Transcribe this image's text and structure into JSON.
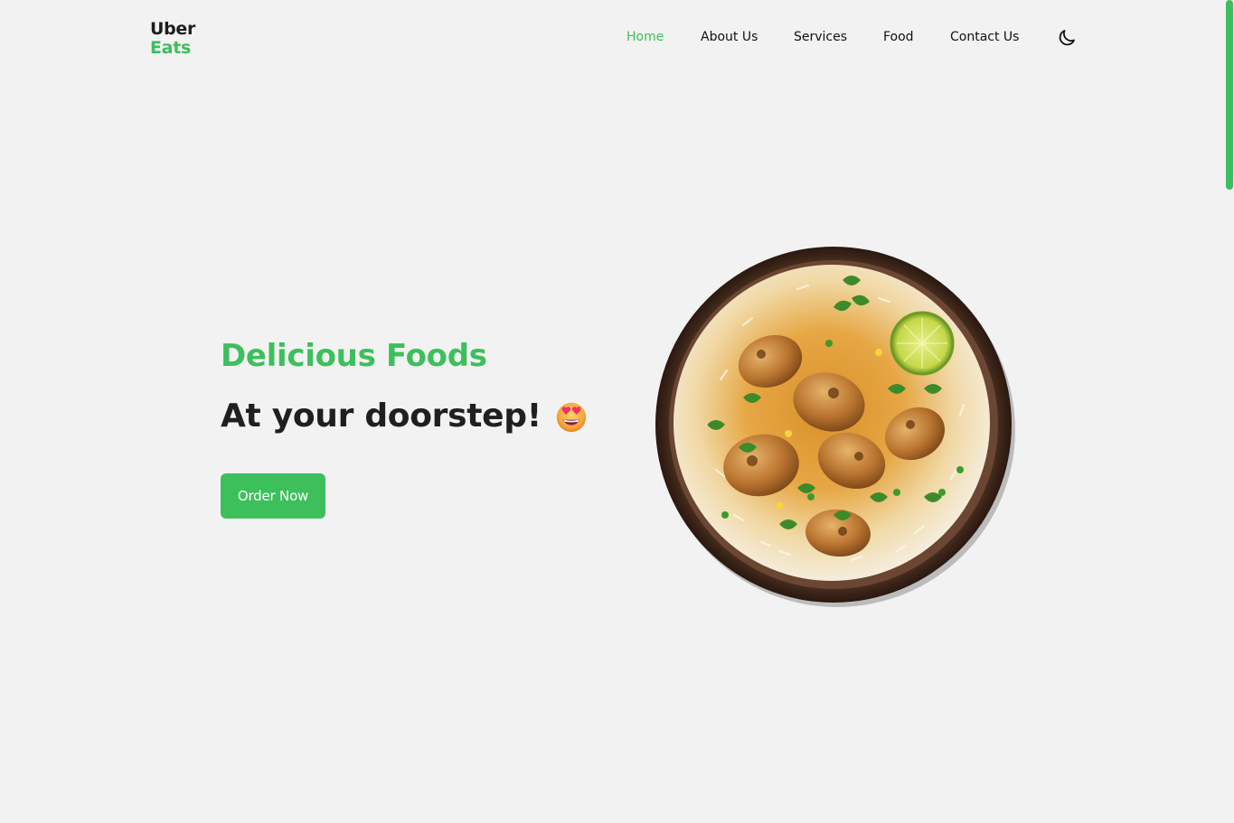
{
  "header": {
    "logo": {
      "line1": "Uber",
      "line2": "Eats"
    },
    "nav": [
      {
        "label": "Home",
        "active": true
      },
      {
        "label": "About Us",
        "active": false
      },
      {
        "label": "Services",
        "active": false
      },
      {
        "label": "Food",
        "active": false
      },
      {
        "label": "Contact Us",
        "active": false
      }
    ],
    "theme_toggle_icon": "moon-icon"
  },
  "hero": {
    "title": "Delicious Foods",
    "subtitle": "At your doorstep!",
    "emoji_icon": "heart-eyes-emoji-icon",
    "cta_label": "Order Now",
    "image_icon": "biryani-bowl-image"
  },
  "colors": {
    "accent": "#3dbf5c",
    "background": "#f2f2f2",
    "text": "#1f1f1f"
  }
}
